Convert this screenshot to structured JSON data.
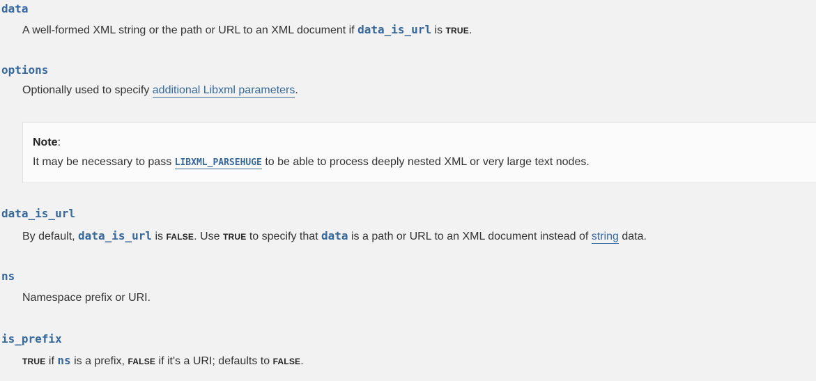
{
  "params": {
    "data": {
      "name": "data",
      "desc_before": "A well-formed XML string or the path or URL to an XML document if ",
      "desc_code": "data_is_url",
      "desc_mid": " is ",
      "desc_const": "TRUE",
      "desc_after": "."
    },
    "options": {
      "name": "options",
      "desc_before": "Optionally used to specify ",
      "desc_link": "additional Libxml parameters",
      "desc_after": "."
    },
    "note": {
      "title": "Note",
      "title_colon": ":",
      "body_before": "It may be necessary to pass ",
      "body_const": "LIBXML_PARSEHUGE",
      "body_after": " to be able to process deeply nested XML or very large text nodes."
    },
    "data_is_url": {
      "name": "data_is_url",
      "desc_1": "By default, ",
      "desc_code1": "data_is_url",
      "desc_2": " is ",
      "desc_const1": "FALSE",
      "desc_3": ". Use ",
      "desc_const2": "TRUE",
      "desc_4": " to specify that ",
      "desc_code2": "data",
      "desc_5": " is a path or URL to an XML document instead of ",
      "desc_link": "string",
      "desc_6": " data."
    },
    "ns": {
      "name": "ns",
      "desc": "Namespace prefix or URI."
    },
    "is_prefix": {
      "name": "is_prefix",
      "desc_const1": "TRUE",
      "desc_1": " if ",
      "desc_code": "ns",
      "desc_2": " is a prefix, ",
      "desc_const2": "FALSE",
      "desc_3": " if it's a URI; defaults to ",
      "desc_const3": "FALSE",
      "desc_4": "."
    }
  }
}
